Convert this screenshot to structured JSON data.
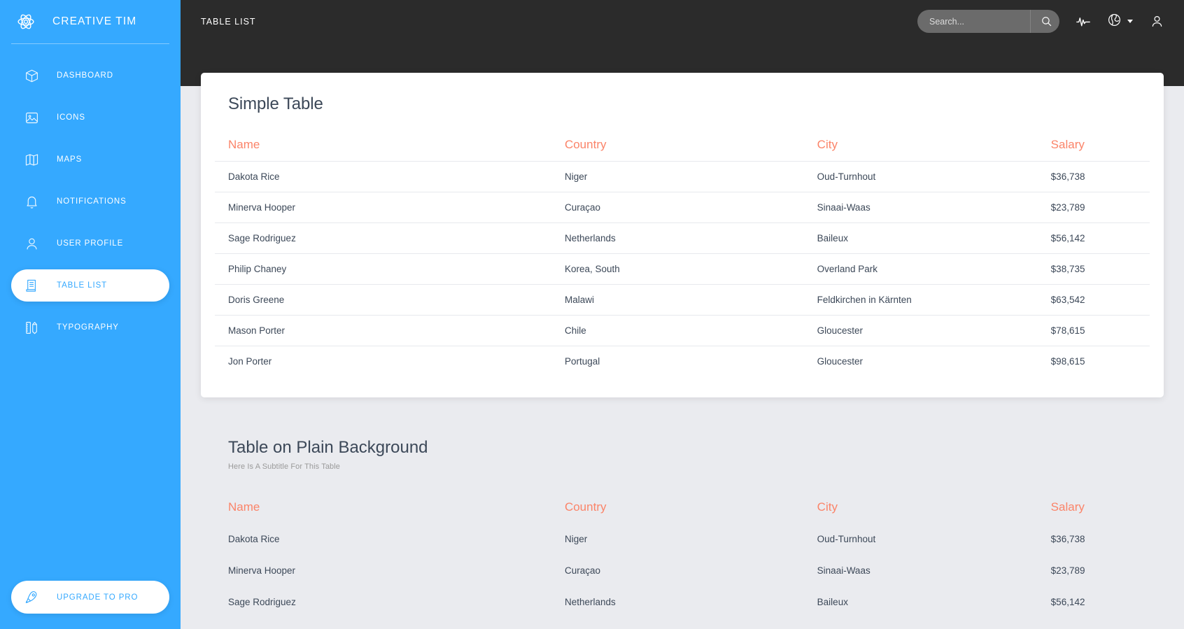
{
  "sidebar": {
    "brand": {
      "logo_icon": "atom-icon",
      "title": "CREATIVE TIM"
    },
    "items": [
      {
        "icon": "cube-icon",
        "label": "DASHBOARD",
        "active": false
      },
      {
        "icon": "image-icon",
        "label": "ICONS",
        "active": false
      },
      {
        "icon": "map-icon",
        "label": "MAPS",
        "active": false
      },
      {
        "icon": "bell-icon",
        "label": "NOTIFICATIONS",
        "active": false
      },
      {
        "icon": "user-icon",
        "label": "USER PROFILE",
        "active": false
      },
      {
        "icon": "table-list-icon",
        "label": "TABLE LIST",
        "active": true
      },
      {
        "icon": "typography-icon",
        "label": "TYPOGRAPHY",
        "active": false
      }
    ],
    "upgrade": {
      "icon": "rocket-icon",
      "label": "UPGRADE TO PRO"
    },
    "accent_color": "#35a9ff",
    "active_text_color": "#35a9ff"
  },
  "navbar": {
    "title": "TABLE LIST",
    "background_color": "#2b2b2b",
    "search": {
      "placeholder": "Search...",
      "value": "",
      "icon": "search-icon"
    },
    "icons": [
      {
        "name": "pulse-icon"
      },
      {
        "name": "globe-icon",
        "caret": "chevron-down-icon"
      },
      {
        "name": "person-icon"
      }
    ]
  },
  "simple_table": {
    "title": "Simple Table",
    "columns": [
      "Name",
      "Country",
      "City",
      "Salary"
    ],
    "rows": [
      {
        "name": "Dakota Rice",
        "country": "Niger",
        "city": "Oud-Turnhout",
        "salary": "$36,738"
      },
      {
        "name": "Minerva Hooper",
        "country": "Curaçao",
        "city": "Sinaai-Waas",
        "salary": "$23,789"
      },
      {
        "name": "Sage Rodriguez",
        "country": "Netherlands",
        "city": "Baileux",
        "salary": "$56,142"
      },
      {
        "name": "Philip Chaney",
        "country": "Korea, South",
        "city": "Overland Park",
        "salary": "$38,735"
      },
      {
        "name": "Doris Greene",
        "country": "Malawi",
        "city": "Feldkirchen in Kärnten",
        "salary": "$63,542"
      },
      {
        "name": "Mason Porter",
        "country": "Chile",
        "city": "Gloucester",
        "salary": "$78,615"
      },
      {
        "name": "Jon Porter",
        "country": "Portugal",
        "city": "Gloucester",
        "salary": "$98,615"
      }
    ]
  },
  "plain_table": {
    "title": "Table on Plain Background",
    "subtitle": "Here Is A Subtitle For This Table",
    "columns": [
      "Name",
      "Country",
      "City",
      "Salary"
    ],
    "rows": [
      {
        "name": "Dakota Rice",
        "country": "Niger",
        "city": "Oud-Turnhout",
        "salary": "$36,738"
      },
      {
        "name": "Minerva Hooper",
        "country": "Curaçao",
        "city": "Sinaai-Waas",
        "salary": "$23,789"
      },
      {
        "name": "Sage Rodriguez",
        "country": "Netherlands",
        "city": "Baileux",
        "salary": "$56,142"
      }
    ]
  },
  "theme": {
    "page_background": "#eaebef",
    "table_header_color": "#fb8469",
    "text_color": "#3c4858"
  }
}
